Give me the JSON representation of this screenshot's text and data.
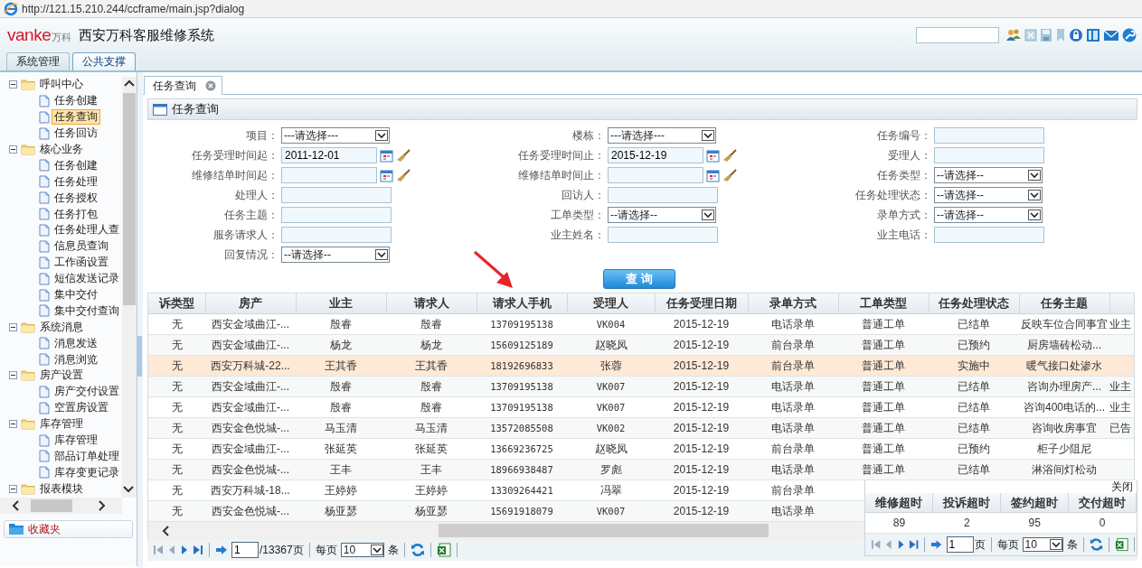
{
  "address_bar": {
    "url": "http://121.15.210.244/ccframe/main.jsp?dialog"
  },
  "header": {
    "logo": "vanke",
    "logo_cn": "万科",
    "title": "西安万科客服维修系统"
  },
  "top_tabs": [
    {
      "label": "系统管理",
      "selected": false
    },
    {
      "label": "公共支撑",
      "selected": true
    }
  ],
  "sidebar": {
    "tree": [
      {
        "label": "呼叫中心",
        "expanded": true,
        "children": [
          {
            "label": "任务创建",
            "selected": false
          },
          {
            "label": "任务查询",
            "selected": true
          },
          {
            "label": "任务回访",
            "selected": false
          }
        ]
      },
      {
        "label": "核心业务",
        "expanded": true,
        "children": [
          {
            "label": "任务创建",
            "selected": false
          },
          {
            "label": "任务处理",
            "selected": false
          },
          {
            "label": "任务授权",
            "selected": false
          },
          {
            "label": "任务打包",
            "selected": false
          },
          {
            "label": "任务处理人查",
            "selected": false
          },
          {
            "label": "信息员查询",
            "selected": false
          },
          {
            "label": "工作函设置",
            "selected": false
          },
          {
            "label": "短信发送记录",
            "selected": false
          },
          {
            "label": "集中交付",
            "selected": false
          },
          {
            "label": "集中交付查询",
            "selected": false
          }
        ]
      },
      {
        "label": "系统消息",
        "expanded": true,
        "children": [
          {
            "label": "消息发送",
            "selected": false
          },
          {
            "label": "消息浏览",
            "selected": false
          }
        ]
      },
      {
        "label": "房产设置",
        "expanded": true,
        "children": [
          {
            "label": "房产交付设置",
            "selected": false
          },
          {
            "label": "空置房设置",
            "selected": false
          }
        ]
      },
      {
        "label": "库存管理",
        "expanded": true,
        "children": [
          {
            "label": "库存管理",
            "selected": false
          },
          {
            "label": "部品订单处理",
            "selected": false
          },
          {
            "label": "库存变更记录",
            "selected": false
          }
        ]
      },
      {
        "label": "报表模块",
        "expanded": true
      }
    ],
    "favorites": "收藏夹"
  },
  "content_tabs": [
    {
      "label": "任务查询",
      "selected": true
    }
  ],
  "panel_title": "任务查询",
  "form": {
    "columns": [
      [
        {
          "label": "项目：",
          "kind": "select",
          "value": "---请选择---"
        },
        {
          "label": "任务受理时间起：",
          "kind": "date",
          "value": "2011-12-01"
        },
        {
          "label": "维修结单时间起：",
          "kind": "date"
        },
        {
          "label": "处理人：",
          "kind": "text"
        },
        {
          "label": "任务主题：",
          "kind": "text"
        },
        {
          "label": "服务请求人：",
          "kind": "text"
        },
        {
          "label": "回复情况：",
          "kind": "select",
          "value": "--请选择--"
        }
      ],
      [
        {
          "label": "楼栋：",
          "kind": "select",
          "value": "---请选择---"
        },
        {
          "label": "任务受理时间止：",
          "kind": "date",
          "value": "2015-12-19"
        },
        {
          "label": "维修结单时间止：",
          "kind": "date"
        },
        {
          "label": "回访人：",
          "kind": "text"
        },
        {
          "label": "工单类型：",
          "kind": "select",
          "value": "--请选择--"
        },
        {
          "label": "业主姓名：",
          "kind": "text"
        }
      ],
      [
        {
          "label": "任务编号：",
          "kind": "text"
        },
        {
          "label": "受理人：",
          "kind": "text"
        },
        {
          "label": "任务类型：",
          "kind": "select",
          "value": "--请选择--"
        },
        {
          "label": "任务处理状态：",
          "kind": "select",
          "value": "--请选择--"
        },
        {
          "label": "录单方式：",
          "kind": "select",
          "value": "--请选择--"
        },
        {
          "label": "业主电话：",
          "kind": "text"
        }
      ]
    ]
  },
  "query_button": "查 询",
  "table": {
    "columns": [
      "诉类型",
      "房产",
      "业主",
      "请求人",
      "请求人手机",
      "受理人",
      "任务受理日期",
      "录单方式",
      "工单类型",
      "任务处理状态",
      "任务主题"
    ],
    "rows": [
      {
        "selected": false,
        "cells": [
          "无",
          "西安金域曲江-...",
          "殷睿",
          "殷睿",
          "13709195138",
          "VK004",
          "2015-12-19",
          "电话录单",
          "普通工单",
          "已结单",
          "反映车位合同事宜",
          "业主"
        ]
      },
      {
        "selected": false,
        "cells": [
          "无",
          "西安金域曲江-...",
          "杨龙",
          "杨龙",
          "15609125189",
          "赵晓凤",
          "2015-12-19",
          "前台录单",
          "普通工单",
          "已预约",
          "厨房墙砖松动..."
        ]
      },
      {
        "selected": true,
        "cells": [
          "无",
          "西安万科城-22...",
          "王其香",
          "王其香",
          "18192696833",
          "张蓉",
          "2015-12-19",
          "前台录单",
          "普通工单",
          "实施中",
          "暖气接口处渗水"
        ]
      },
      {
        "selected": false,
        "cells": [
          "无",
          "西安金域曲江-...",
          "殷睿",
          "殷睿",
          "13709195138",
          "VK007",
          "2015-12-19",
          "电话录单",
          "普通工单",
          "已结单",
          "咨询办理房产...",
          "业主"
        ]
      },
      {
        "selected": false,
        "cells": [
          "无",
          "西安金域曲江-...",
          "殷睿",
          "殷睿",
          "13709195138",
          "VK007",
          "2015-12-19",
          "电话录单",
          "普通工单",
          "已结单",
          "咨询400电话的...",
          "业主"
        ]
      },
      {
        "selected": false,
        "cells": [
          "无",
          "西安金色悦城-...",
          "马玉清",
          "马玉清",
          "13572085508",
          "VK002",
          "2015-12-19",
          "电话录单",
          "普通工单",
          "已结单",
          "咨询收房事宜",
          "已告"
        ]
      },
      {
        "selected": false,
        "cells": [
          "无",
          "西安金域曲江-...",
          "张延英",
          "张延英",
          "13669236725",
          "赵晓凤",
          "2015-12-19",
          "前台录单",
          "普通工单",
          "已预约",
          "柜子少阻尼"
        ]
      },
      {
        "selected": false,
        "cells": [
          "无",
          "西安金色悦城-...",
          "王丰",
          "王丰",
          "18966938487",
          "罗彪",
          "2015-12-19",
          "电话录单",
          "普通工单",
          "已结单",
          "淋浴间灯松动"
        ]
      },
      {
        "selected": false,
        "cells": [
          "无",
          "西安万科城-18...",
          "王婷婷",
          "王婷婷",
          "13309264421",
          "冯翠",
          "2015-12-19",
          "前台录单"
        ]
      },
      {
        "selected": false,
        "cells": [
          "无",
          "西安金色悦城-...",
          "杨亚瑟",
          "杨亚瑟",
          "15691918079",
          "VK007",
          "2015-12-19",
          "电话录单"
        ]
      }
    ]
  },
  "pager": {
    "page": "1",
    "total": "/13367页",
    "per_page_label": "每页",
    "per_page": "10",
    "unit": "条"
  },
  "popup": {
    "close": "关闭",
    "columns": [
      "维修超时",
      "投诉超时",
      "签约超时",
      "交付超时"
    ],
    "values": [
      "89",
      "2",
      "95",
      "0"
    ],
    "pager": {
      "page": "1",
      "total": "页",
      "per_page_label": "每页",
      "per_page": "10",
      "unit": "条"
    }
  }
}
